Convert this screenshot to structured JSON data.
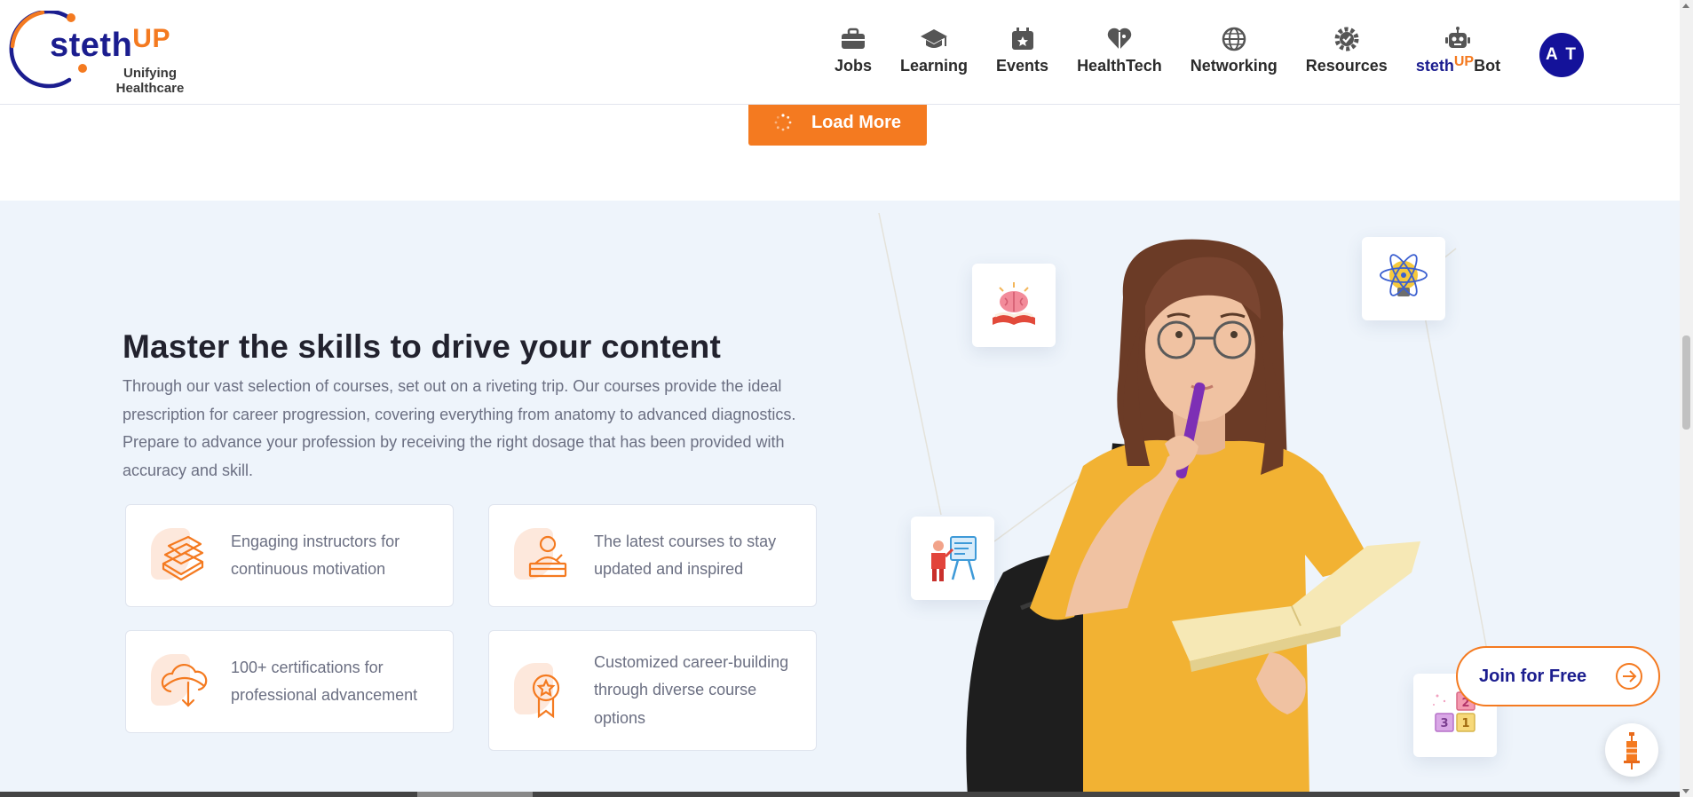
{
  "brand": {
    "name_main": "steth",
    "name_accent": "UP",
    "tagline_line1": "Unifying",
    "tagline_line2": "Healthcare"
  },
  "nav": {
    "items": [
      {
        "label": "Jobs",
        "icon": "briefcase-icon"
      },
      {
        "label": "Learning",
        "icon": "graduation-cap-icon"
      },
      {
        "label": "Events",
        "icon": "calendar-star-icon"
      },
      {
        "label": "HealthTech",
        "icon": "heart-tech-icon"
      },
      {
        "label": "Networking",
        "icon": "globe-icon"
      },
      {
        "label": "Resources",
        "icon": "gear-check-icon"
      }
    ],
    "bot": {
      "prefix": "steth",
      "accent": "UP",
      "suffix": "Bot",
      "icon": "robot-icon"
    },
    "avatar_initials": "A T"
  },
  "load_more_label": "Load More",
  "section": {
    "title": "Master the skills to drive your content",
    "paragraph": "Through our vast selection of courses, set out on a riveting trip. Our courses provide the ideal prescription for career progression, covering everything from anatomy to advanced diagnostics. Prepare to advance your profession by receiving the right dosage that has been provided with accuracy and skill.",
    "features": [
      {
        "text": "Engaging instructors for continuous motivation",
        "icon": "books-icon"
      },
      {
        "text": "The latest courses to stay updated and inspired",
        "icon": "teacher-podium-icon"
      },
      {
        "text": "100+ certifications for professional advancement",
        "icon": "cloud-download-icon"
      },
      {
        "text": "Customized career-building through diverse course options",
        "icon": "award-ribbon-icon"
      }
    ]
  },
  "cta": {
    "join_label": "Join for Free"
  },
  "colors": {
    "brand_blue": "#1b1d8f",
    "brand_orange": "#f47a20",
    "section_bg": "#eef4fb"
  }
}
